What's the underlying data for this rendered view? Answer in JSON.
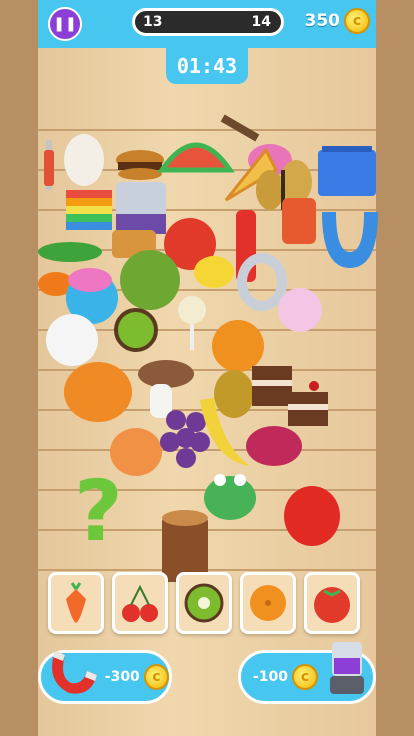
{
  "hud": {
    "pause_icon": "pause-icon",
    "progress_left": "13",
    "progress_right": "14",
    "coins": "350",
    "coin_symbol": "c",
    "timer": "01:43"
  },
  "items": [
    "fork",
    "egg",
    "hamburger",
    "watermelon",
    "ukulele",
    "shopping-basket",
    "pizza-slice",
    "butterfly",
    "rainbow-cake",
    "pot",
    "tomato",
    "magnet",
    "peas",
    "waffle",
    "lemon",
    "number-zero",
    "goldfish",
    "garlic",
    "mushroom-cake",
    "kiwi",
    "lollipop",
    "milk-bottle",
    "orange",
    "pumpkin",
    "mushroom",
    "mango",
    "cake-slice",
    "grapes",
    "banana",
    "onion",
    "beet",
    "question-mark",
    "frog",
    "log",
    "strawberry"
  ],
  "tray": {
    "slots": [
      {
        "icon": "carrot-icon"
      },
      {
        "icon": "cherries-icon"
      },
      {
        "icon": "kiwi-icon"
      },
      {
        "icon": "orange-icon"
      },
      {
        "icon": "tomato-icon"
      }
    ]
  },
  "powerups": {
    "magnet_cost": "-300",
    "blender_cost": "-100",
    "coin_symbol": "c"
  },
  "colors": {
    "accent": "#47c7f0",
    "pause": "#8b3fd6",
    "coin": "#f2b400"
  }
}
